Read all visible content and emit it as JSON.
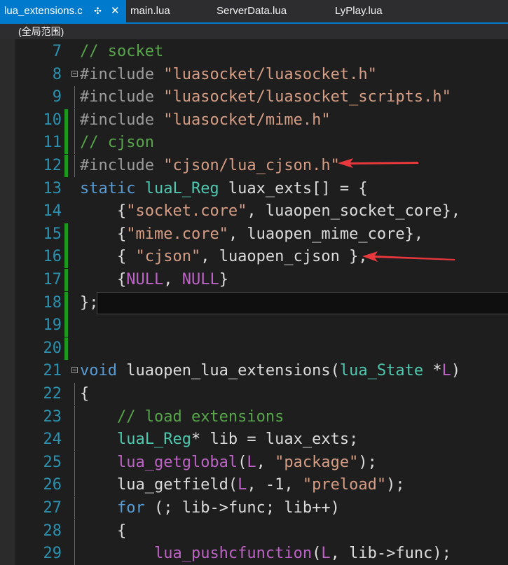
{
  "tabs": [
    {
      "label": "lua_extensions.c",
      "active": true
    },
    {
      "label": "main.lua"
    },
    {
      "label": "ServerData.lua"
    },
    {
      "label": "LyPlay.lua"
    }
  ],
  "scope": "(全局范围)",
  "lines": [
    {
      "num": "7",
      "parts": [
        [
          "c-cmt",
          "// socket"
        ]
      ]
    },
    {
      "num": "8",
      "parts": [
        [
          "c-pp",
          "#include "
        ],
        [
          "c-str",
          "\"luasocket/luasocket.h\""
        ]
      ]
    },
    {
      "num": "9",
      "parts": [
        [
          "c-pp",
          "#include "
        ],
        [
          "c-str",
          "\"luasocket/luasocket_scripts.h\""
        ]
      ]
    },
    {
      "num": "10",
      "parts": [
        [
          "c-pp",
          "#include "
        ],
        [
          "c-str",
          "\"luasocket/mime.h\""
        ]
      ]
    },
    {
      "num": "11",
      "parts": [
        [
          "c-cmt",
          "// cjson"
        ]
      ]
    },
    {
      "num": "12",
      "parts": [
        [
          "c-pp",
          "#include "
        ],
        [
          "c-str",
          "\"cjson/lua_cjson.h\""
        ]
      ]
    },
    {
      "num": "13",
      "parts": [
        [
          "c-kw",
          "static "
        ],
        [
          "c-type",
          "luaL_Reg"
        ],
        [
          "",
          " luax_exts[] = {"
        ]
      ]
    },
    {
      "num": "14",
      "parts": [
        [
          "",
          "    {"
        ],
        [
          "c-str",
          "\"socket.core\""
        ],
        [
          "",
          ", luaopen_socket_core},"
        ]
      ]
    },
    {
      "num": "15",
      "parts": [
        [
          "",
          "    {"
        ],
        [
          "c-str",
          "\"mime.core\""
        ],
        [
          "",
          ", luaopen_mime_core},"
        ]
      ]
    },
    {
      "num": "16",
      "parts": [
        [
          "",
          "    { "
        ],
        [
          "c-str",
          "\"cjson\""
        ],
        [
          "",
          ", luaopen_cjson },"
        ]
      ]
    },
    {
      "num": "17",
      "parts": [
        [
          "",
          "    {"
        ],
        [
          "c-mac",
          "NULL"
        ],
        [
          "",
          ", "
        ],
        [
          "c-mac",
          "NULL"
        ],
        [
          "",
          "}"
        ]
      ]
    },
    {
      "num": "18",
      "parts": [
        [
          "",
          "};"
        ]
      ]
    },
    {
      "num": "19",
      "parts": []
    },
    {
      "num": "20",
      "parts": []
    },
    {
      "num": "21",
      "parts": [
        [
          "c-kw",
          "void"
        ],
        [
          "",
          " luaopen_lua_extensions("
        ],
        [
          "c-type",
          "lua_State"
        ],
        [
          "",
          " *"
        ],
        [
          "c-mac",
          "L"
        ],
        [
          "",
          ")"
        ]
      ]
    },
    {
      "num": "22",
      "parts": [
        [
          "",
          "{"
        ]
      ]
    },
    {
      "num": "23",
      "parts": [
        [
          "",
          "    "
        ],
        [
          "c-cmt",
          "// load extensions"
        ]
      ]
    },
    {
      "num": "24",
      "parts": [
        [
          "",
          "    "
        ],
        [
          "c-type",
          "luaL_Reg"
        ],
        [
          "",
          "* lib = luax_exts;"
        ]
      ]
    },
    {
      "num": "25",
      "parts": [
        [
          "",
          "    "
        ],
        [
          "c-mac",
          "lua_getglobal"
        ],
        [
          "",
          "("
        ],
        [
          "c-mac",
          "L"
        ],
        [
          "",
          ", "
        ],
        [
          "c-str",
          "\"package\""
        ],
        [
          "",
          ");"
        ]
      ]
    },
    {
      "num": "26",
      "parts": [
        [
          "",
          "    lua_getfield("
        ],
        [
          "c-mac",
          "L"
        ],
        [
          "",
          ", -1, "
        ],
        [
          "c-str",
          "\"preload\""
        ],
        [
          "",
          ");"
        ]
      ]
    },
    {
      "num": "27",
      "parts": [
        [
          "",
          "    "
        ],
        [
          "c-kw",
          "for"
        ],
        [
          "",
          " (; lib->func; lib++)"
        ]
      ]
    },
    {
      "num": "28",
      "parts": [
        [
          "",
          "    {"
        ]
      ]
    },
    {
      "num": "29",
      "parts": [
        [
          "",
          "        "
        ],
        [
          "c-mac",
          "lua_pushcfunction"
        ],
        [
          "",
          "("
        ],
        [
          "c-mac",
          "L"
        ],
        [
          "",
          ", lib->func);"
        ]
      ]
    }
  ],
  "colors": {
    "accent": "#007acc",
    "change_bar": "#1d9a1d",
    "arrow": "#e8383d"
  }
}
